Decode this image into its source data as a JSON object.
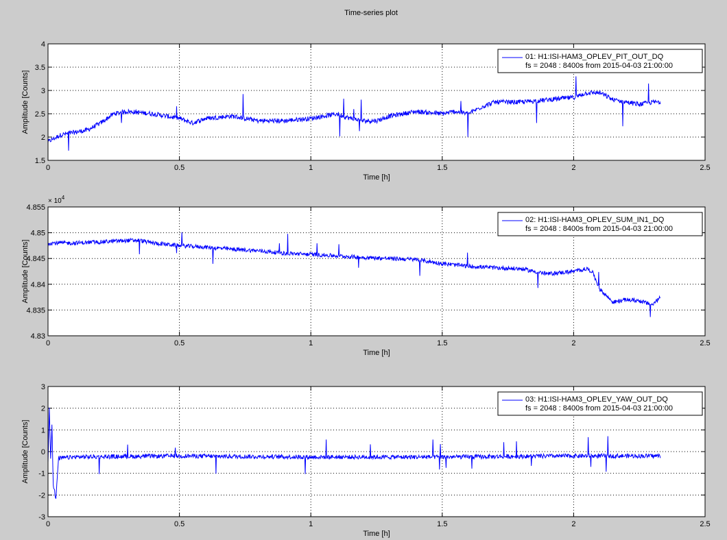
{
  "figure": {
    "title": "Time-series plot",
    "background": "#cccccc",
    "plot_background": "#ffffff",
    "line_color": "#0000ff"
  },
  "chart_data": [
    {
      "type": "line",
      "xlabel": "Time [h]",
      "ylabel": "Amplitude [Counts]",
      "xlim": [
        0,
        2.5
      ],
      "ylim": [
        1.5,
        4
      ],
      "xticks": [
        "0",
        "0.5",
        "1",
        "1.5",
        "2",
        "2.5"
      ],
      "yticks": [
        "1.5",
        "2",
        "2.5",
        "3",
        "3.5",
        "4"
      ],
      "y_exponent": "",
      "grid": true,
      "legend": {
        "placement": "top-right",
        "lines": [
          "01: H1:ISI-HAM3_OPLEV_PIT_OUT_DQ",
          "fs = 2048 : 8400s from 2015-04-03 21:00:00"
        ]
      },
      "series": [
        {
          "name": "01: H1:ISI-HAM3_OPLEV_PIT_OUT_DQ",
          "color": "#0000ff",
          "x": [
            0,
            0.05,
            0.1,
            0.15,
            0.2,
            0.25,
            0.3,
            0.4,
            0.5,
            0.55,
            0.6,
            0.7,
            0.8,
            0.9,
            1.0,
            1.1,
            1.15,
            1.2,
            1.25,
            1.3,
            1.4,
            1.5,
            1.55,
            1.6,
            1.65,
            1.7,
            1.8,
            1.9,
            2.0,
            2.05,
            2.1,
            2.15,
            2.2,
            2.25,
            2.3,
            2.33
          ],
          "y": [
            1.9,
            2.05,
            2.1,
            2.15,
            2.3,
            2.5,
            2.55,
            2.5,
            2.4,
            2.3,
            2.4,
            2.45,
            2.35,
            2.35,
            2.4,
            2.5,
            2.4,
            2.35,
            2.35,
            2.45,
            2.55,
            2.5,
            2.55,
            2.5,
            2.65,
            2.75,
            2.75,
            2.8,
            2.85,
            2.95,
            2.95,
            2.8,
            2.75,
            2.7,
            2.75,
            2.75
          ],
          "noise": 0.05
        }
      ]
    },
    {
      "type": "line",
      "xlabel": "Time [h]",
      "ylabel": "Amplitude [Counts]",
      "xlim": [
        0,
        2.5
      ],
      "ylim": [
        4.83,
        4.855
      ],
      "xticks": [
        "0",
        "0.5",
        "1",
        "1.5",
        "2",
        "2.5"
      ],
      "yticks": [
        "4.83",
        "4.835",
        "4.84",
        "4.845",
        "4.85",
        "4.855"
      ],
      "y_exponent": "4",
      "grid": true,
      "legend": {
        "placement": "top-right",
        "lines": [
          "02: H1:ISI-HAM3_OPLEV_SUM_IN1_DQ",
          "fs = 2048 : 8400s from 2015-04-03 21:00:00"
        ]
      },
      "series": [
        {
          "name": "02: H1:ISI-HAM3_OPLEV_SUM_IN1_DQ",
          "color": "#0000ff",
          "x": [
            0,
            0.1,
            0.2,
            0.3,
            0.35,
            0.4,
            0.5,
            0.6,
            0.7,
            0.8,
            0.9,
            1.0,
            1.1,
            1.2,
            1.3,
            1.4,
            1.5,
            1.6,
            1.7,
            1.8,
            1.9,
            2.0,
            2.05,
            2.07,
            2.1,
            2.15,
            2.2,
            2.25,
            2.3,
            2.33
          ],
          "y": [
            4.848,
            4.848,
            4.8482,
            4.8485,
            4.8485,
            4.848,
            4.8475,
            4.8472,
            4.8468,
            4.8465,
            4.846,
            4.8458,
            4.8455,
            4.8452,
            4.845,
            4.8448,
            4.844,
            4.8435,
            4.8432,
            4.843,
            4.842,
            4.8425,
            4.843,
            4.8425,
            4.839,
            4.8365,
            4.837,
            4.8368,
            4.836,
            4.8375
          ],
          "noise": 0.0004
        }
      ]
    },
    {
      "type": "line",
      "xlabel": "Time [h]",
      "ylabel": "Amplitude [Counts]",
      "xlim": [
        0,
        2.5
      ],
      "ylim": [
        -3,
        3
      ],
      "xticks": [
        "0",
        "0.5",
        "1",
        "1.5",
        "2",
        "2.5"
      ],
      "yticks": [
        "-3",
        "-2",
        "-1",
        "0",
        "1",
        "2",
        "3"
      ],
      "y_exponent": "",
      "grid": true,
      "legend": {
        "placement": "top-right",
        "lines": [
          "03: H1:ISI-HAM3_OPLEV_YAW_OUT_DQ",
          "fs = 2048 : 8400s from 2015-04-03 21:00:00"
        ]
      },
      "series": [
        {
          "name": "03: H1:ISI-HAM3_OPLEV_YAW_OUT_DQ",
          "color": "#0000ff",
          "x": [
            0,
            0.005,
            0.01,
            0.015,
            0.02,
            0.03,
            0.04,
            0.05,
            0.1,
            0.5,
            1.0,
            1.5,
            2.0,
            2.33
          ],
          "y": [
            -0.5,
            2.0,
            -0.3,
            1.2,
            -1.5,
            -2.2,
            -0.3,
            -0.3,
            -0.25,
            -0.2,
            -0.25,
            -0.25,
            -0.2,
            -0.2
          ],
          "noise": 0.1
        }
      ]
    }
  ]
}
